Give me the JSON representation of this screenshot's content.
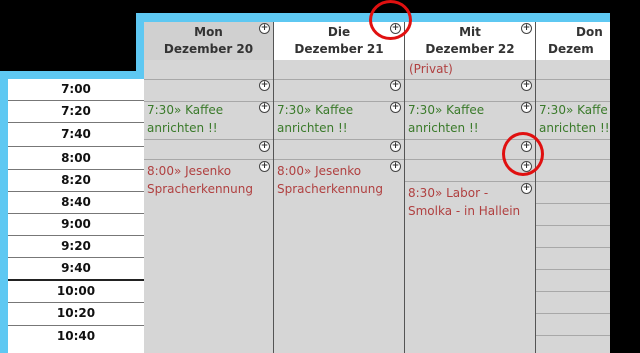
{
  "columns": [
    {
      "day": "Mon",
      "date": "Dezember 20"
    },
    {
      "day": "Die",
      "date": "Dezember 21"
    },
    {
      "day": "Mit",
      "date": "Dezember 22"
    },
    {
      "day": "Don",
      "date": "Dezem"
    }
  ],
  "times": [
    "7:00",
    "7:20",
    "7:40",
    "8:00",
    "8:20",
    "8:40",
    "9:00",
    "9:20",
    "9:40",
    "10:00",
    "10:20",
    "10:40"
  ],
  "plus_symbol": "+",
  "privat_label": "(Privat)",
  "events": {
    "mon_kaffee": [
      "7:30» Kaffee",
      "anrichten !!"
    ],
    "die_kaffee": [
      "7:30» Kaffee",
      "anrichten !!"
    ],
    "mit_kaffee": [
      "7:30» Kaffee",
      "anrichten !!"
    ],
    "don_kaffee": [
      "7:30» Kaffe",
      "anrichten !!"
    ],
    "mon_jesenko": [
      "8:00» Jesenko",
      "Spracherkennung"
    ],
    "die_jesenko": [
      "8:00» Jesenko",
      "Spracherkennung"
    ],
    "mit_labor": [
      "8:30» Labor -",
      "Smolka - in Hallein"
    ]
  },
  "colors": {
    "frame": "#5ec8f2",
    "event_green": "#3a7a2a",
    "event_red": "#b04040",
    "highlight": "#e01010"
  }
}
